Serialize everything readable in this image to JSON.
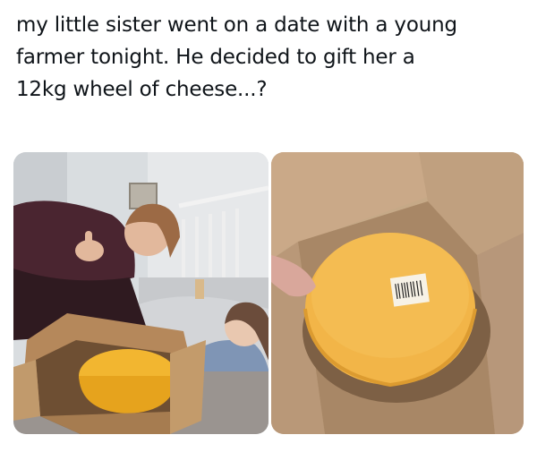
{
  "post": {
    "text_lines": [
      "my little sister went on a date with a young",
      "farmer tonight. He decided to gift her a",
      "12kg wheel of cheese...?"
    ]
  },
  "media": {
    "photos": [
      {
        "subject": "two-girls-with-cheese-box"
      },
      {
        "subject": "cheese-wheel-in-box"
      }
    ]
  }
}
